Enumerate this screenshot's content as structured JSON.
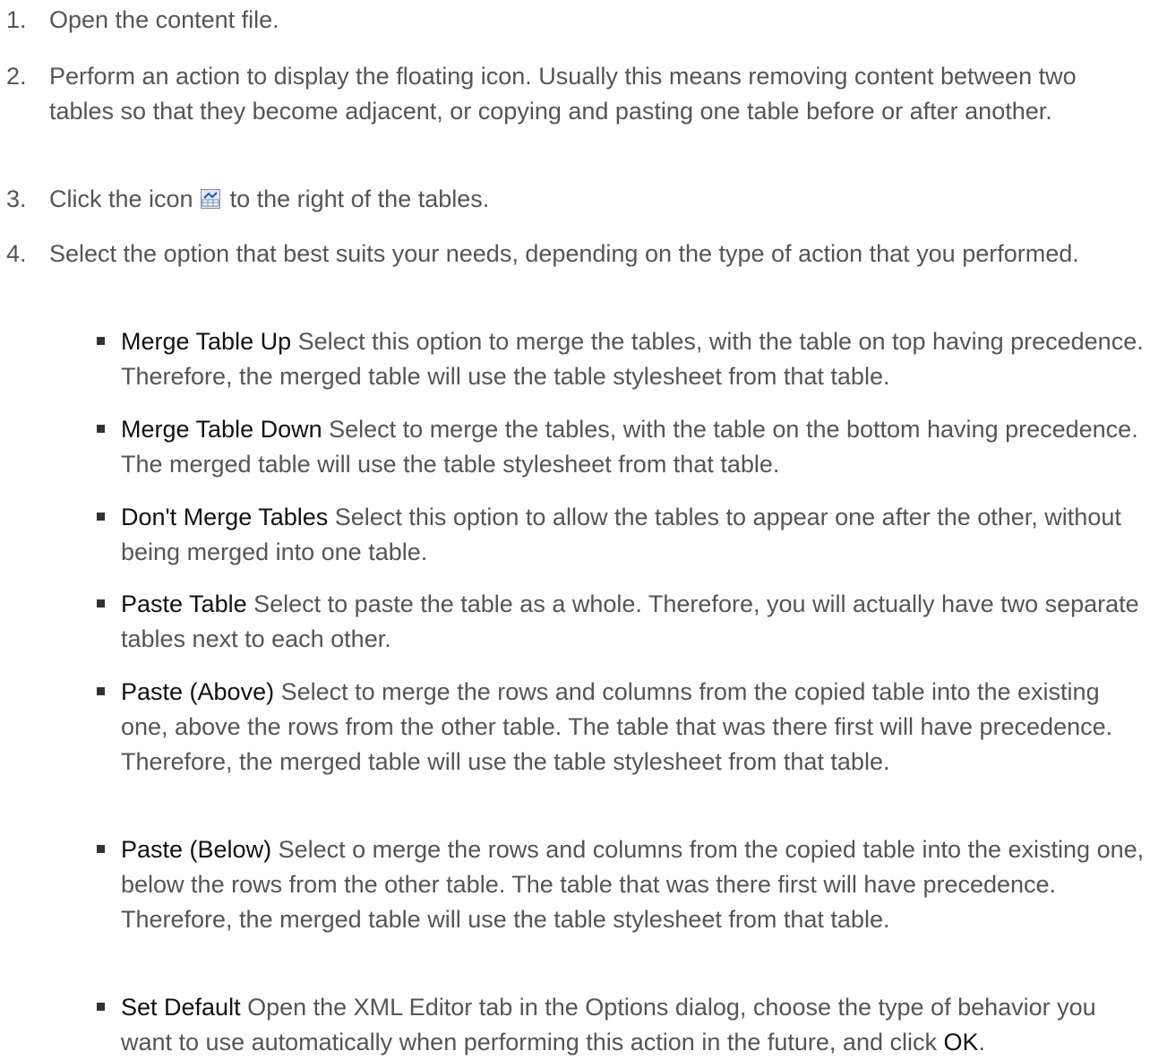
{
  "steps": [
    {
      "num": "1.",
      "text": "Open the content file."
    },
    {
      "num": "2.",
      "text": "Perform an action to display the floating icon. Usually this means removing content between two tables so that they become adjacent, or copying and pasting one table before or after another."
    },
    {
      "num": "3.",
      "text_before": "Click the icon ",
      "icon": "merge-tables-icon",
      "text_after": " to the right of the tables."
    },
    {
      "num": "4.",
      "text": "Select the option that best suits your needs, depending on the type of action that you performed."
    }
  ],
  "options": [
    {
      "term": "Merge Table Up",
      "desc": " Select this option to merge the tables, with the table on top having precedence. Therefore, the merged table will use the table stylesheet from that table."
    },
    {
      "term": "Merge Table Down",
      "desc": " Select to merge the tables, with the table on the bottom having precedence. The merged table will use the table stylesheet from that table."
    },
    {
      "term": "Don't Merge Tables",
      "desc": " Select this option to allow the tables to appear one after the other, without being merged into one table."
    },
    {
      "term": "Paste Table",
      "desc": " Select to paste the table as a whole. Therefore, you will actually have two separate tables next to each other."
    },
    {
      "term": "Paste (Above)",
      "desc": " Select to merge the rows and columns from the copied table into the existing one, above the rows from the other table. The table that was there first will have precedence. Therefore, the merged table will use the table stylesheet from that table."
    },
    {
      "term": "Paste (Below)",
      "desc": " Select  o merge the rows and columns from the copied table into the existing one, below the rows from the other table. The table that was there first will have precedence. Therefore, the merged table will use the table stylesheet from that table."
    },
    {
      "term": "Set Default",
      "desc": " Open the XML Editor tab in the Options dialog, choose the type of behavior you want to use automatically when performing this action in the future, and click ",
      "ok": "OK",
      "end": "."
    }
  ]
}
